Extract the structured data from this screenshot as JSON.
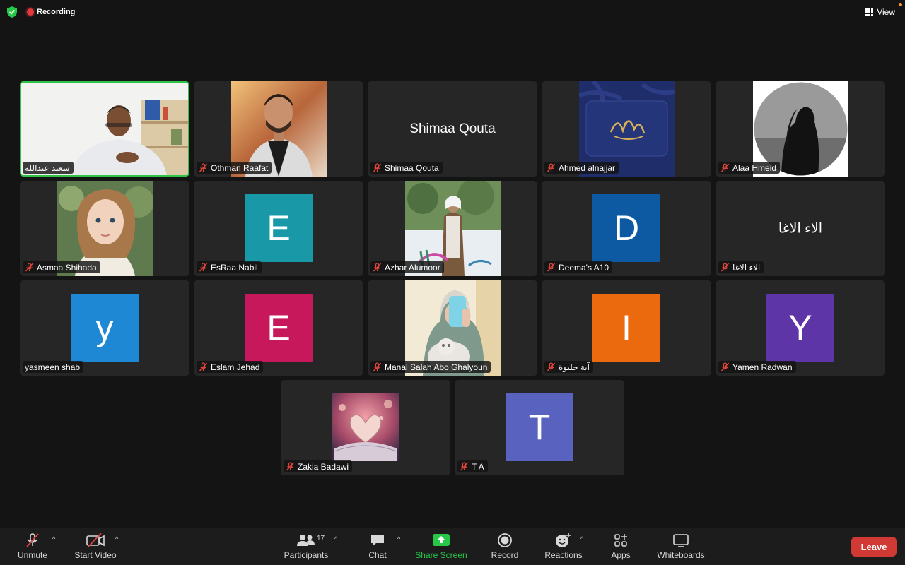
{
  "status": {
    "recording_label": "Recording",
    "view_label": "View"
  },
  "tiles": [
    {
      "name": "سعيد عبدالله"
    },
    {
      "name": "Othman Raafat"
    },
    {
      "name": "Shimaa Qouta",
      "display": "Shimaa Qouta"
    },
    {
      "name": "Ahmed alnajjar"
    },
    {
      "name": "Alaa Hmeid"
    },
    {
      "name": "Asmaa Shihada"
    },
    {
      "name": "EsRaa Nabil",
      "initial": "E",
      "color": "#1999a8"
    },
    {
      "name": "Azhar Alumoor"
    },
    {
      "name": "Deema's A10",
      "initial": "D",
      "color": "#0d5aa3"
    },
    {
      "name": "الاء الاغا",
      "display": "الاء الاغا"
    },
    {
      "name": "yasmeen shab",
      "initial": "y",
      "color": "#1e88d4"
    },
    {
      "name": "Eslam Jehad",
      "initial": "E",
      "color": "#c7185c"
    },
    {
      "name": "Manal Salah Abo Ghalyoun"
    },
    {
      "name": "آية حليوة",
      "initial": "I",
      "color": "#ec6a0e"
    },
    {
      "name": "Yamen Radwan",
      "initial": "Y",
      "color": "#5d35a6"
    },
    {
      "name": "Zakia Badawi"
    },
    {
      "name": "T A",
      "initial": "T",
      "color": "#5962bf"
    }
  ],
  "toolbar": {
    "unmute": "Unmute",
    "start_video": "Start Video",
    "participants": "Participants",
    "participant_count": "17",
    "chat": "Chat",
    "share_screen": "Share Screen",
    "record": "Record",
    "reactions": "Reactions",
    "apps": "Apps",
    "whiteboards": "Whiteboards",
    "leave": "Leave"
  },
  "colors": {
    "accent_green": "#27c748",
    "leave_red": "#d13a34",
    "recording_red": "#e5383b",
    "active_border": "#2fc349"
  }
}
